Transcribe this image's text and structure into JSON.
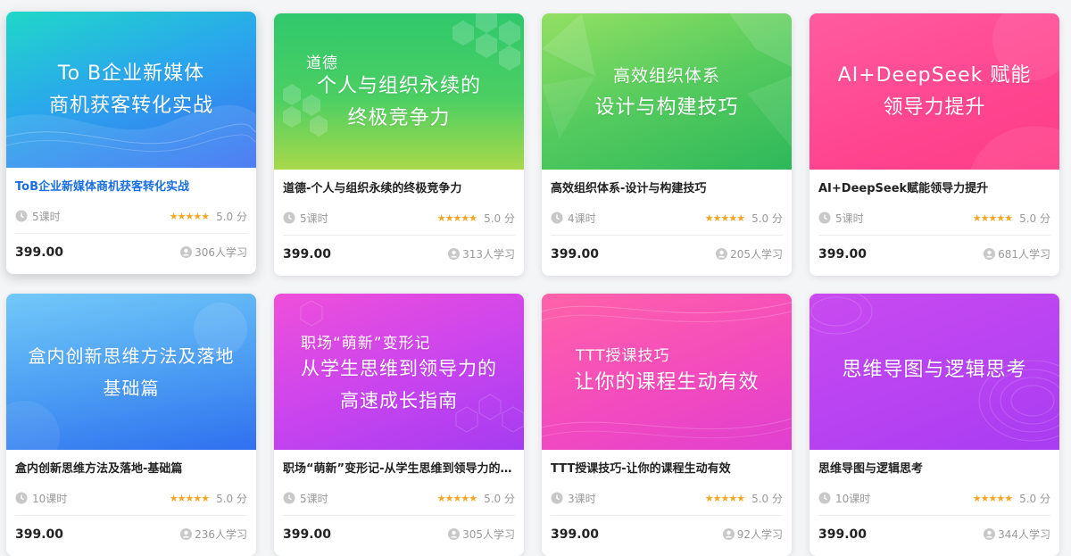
{
  "courses": [
    {
      "cover": {
        "lines": [
          "To B企业新媒体",
          "商机获客转化实战"
        ],
        "colors": [
          "#1fd3c8",
          "#2e7bf0"
        ]
      },
      "title": "ToB企业新媒体商机获客转化实战",
      "lessons": "5课时",
      "stars": "★★★★★",
      "score": "5.0 分",
      "price": "399.00",
      "learners": "306人学习"
    },
    {
      "cover": {
        "small": "道德",
        "lines": [
          "个人与组织永续的",
          "终极竞争力"
        ],
        "colors": [
          "#35c771",
          "#a8d64a"
        ]
      },
      "title": "道德-个人与组织永续的终极竞争力",
      "lessons": "5课时",
      "stars": "★★★★★",
      "score": "5.0 分",
      "price": "399.00",
      "learners": "313人学习"
    },
    {
      "cover": {
        "lines": [
          "高效组织体系",
          "设计与构建技巧"
        ],
        "colors": [
          "#8fdc5a",
          "#2fb85d"
        ]
      },
      "title": "高效组织体系-设计与构建技巧",
      "lessons": "4课时",
      "stars": "★★★★★",
      "score": "5.0 分",
      "price": "399.00",
      "learners": "205人学习"
    },
    {
      "cover": {
        "lines": [
          "AI+DeepSeek 赋能",
          "领导力提升"
        ],
        "colors": [
          "#ff4f9a",
          "#ff3d8b"
        ]
      },
      "title": "AI+DeepSeek赋能领导力提升",
      "lessons": "5课时",
      "stars": "★★★★★",
      "score": "5.0 分",
      "price": "399.00",
      "learners": "681人学习"
    },
    {
      "cover": {
        "lines": [
          "盒内创新思维方法及落地",
          "基础篇"
        ],
        "colors": [
          "#6ec6f7",
          "#2e7bf0"
        ]
      },
      "title": "盒内创新思维方法及落地-基础篇",
      "lessons": "10课时",
      "stars": "★★★★★",
      "score": "5.0 分",
      "price": "399.00",
      "learners": "236人学习"
    },
    {
      "cover": {
        "small": "职场“萌新”变形记",
        "lines": [
          "从学生思维到领导力的",
          "高速成长指南"
        ],
        "colors": [
          "#f04fd8",
          "#a53cf0"
        ]
      },
      "title": "职场“萌新”变形记-从学生思维到领导力的高速成长指南",
      "lessons": "5课时",
      "stars": "★★★★★",
      "score": "5.0 分",
      "price": "399.00",
      "learners": "305人学习"
    },
    {
      "cover": {
        "small": "TTT授课技巧",
        "lines": [
          "让你的课程生动有效"
        ],
        "colors": [
          "#ff5aa6",
          "#e83fc8"
        ]
      },
      "title": "TTT授课技巧-让你的课程生动有效",
      "lessons": "3课时",
      "stars": "★★★★★",
      "score": "5.0 分",
      "price": "399.00",
      "learners": "92人学习"
    },
    {
      "cover": {
        "lines": [
          "思维导图与逻辑思考"
        ],
        "colors": [
          "#c94af0",
          "#b23cf2"
        ]
      },
      "title": "思维导图与逻辑思考",
      "lessons": "10课时",
      "stars": "★★★★★",
      "score": "5.0 分",
      "price": "399.00",
      "learners": "344人学习"
    }
  ]
}
